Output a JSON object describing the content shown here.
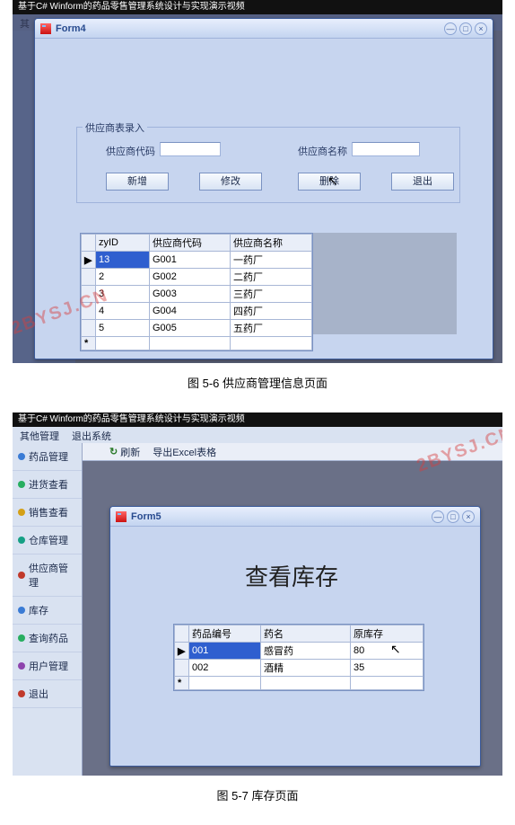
{
  "watermark": "2BYSJ.CN",
  "video_title": "基于C# Winform的药品零售管理系统设计与实现演示视频",
  "figure1": {
    "caption": "图 5-6 供应商管理信息页面",
    "window": {
      "title": "Form4"
    },
    "window_controls": {
      "min": "—",
      "max": "□",
      "close": "×"
    },
    "groupbox_title": "供应商表录入",
    "labels": {
      "code": "供应商代码",
      "name": "供应商名称"
    },
    "buttons": {
      "add": "新增",
      "edit": "修改",
      "del": "删除",
      "exit": "退出"
    },
    "bg_menu": "其",
    "grid": {
      "cols": [
        "zyID",
        "供应商代码",
        "供应商名称"
      ],
      "rows": [
        {
          "zyID": "13",
          "code": "G001",
          "name": "一药厂",
          "selected": true
        },
        {
          "zyID": "2",
          "code": "G002",
          "name": "二药厂"
        },
        {
          "zyID": "3",
          "code": "G003",
          "name": "三药厂"
        },
        {
          "zyID": "4",
          "code": "G004",
          "name": "四药厂"
        },
        {
          "zyID": "5",
          "code": "G005",
          "name": "五药厂"
        }
      ]
    }
  },
  "figure2": {
    "caption": "图 5-7 库存页面",
    "top_menu": [
      "其他管理",
      "退出系统"
    ],
    "toolbar": {
      "refresh": "刷新",
      "export": "导出Excel表格"
    },
    "sidebar": [
      {
        "label": "药品管理",
        "dot": "dot-blue"
      },
      {
        "label": "进货查看",
        "dot": "dot-green"
      },
      {
        "label": "销售查看",
        "dot": "dot-yellow"
      },
      {
        "label": "仓库管理",
        "dot": "dot-cyan"
      },
      {
        "label": "供应商管理",
        "dot": "dot-red"
      },
      {
        "label": "库存",
        "dot": "dot-blue"
      },
      {
        "label": "查询药品",
        "dot": "dot-green"
      },
      {
        "label": "用户管理",
        "dot": "dot-purple"
      },
      {
        "label": "退出",
        "dot": "dot-red"
      }
    ],
    "window": {
      "title": "Form5"
    },
    "heading": "查看库存",
    "grid": {
      "cols": [
        "药品编号",
        "药名",
        "原库存"
      ],
      "rows": [
        {
          "id": "001",
          "name": "感冒药",
          "stock": "80",
          "selected": true
        },
        {
          "id": "002",
          "name": "酒精",
          "stock": "35"
        }
      ]
    }
  }
}
